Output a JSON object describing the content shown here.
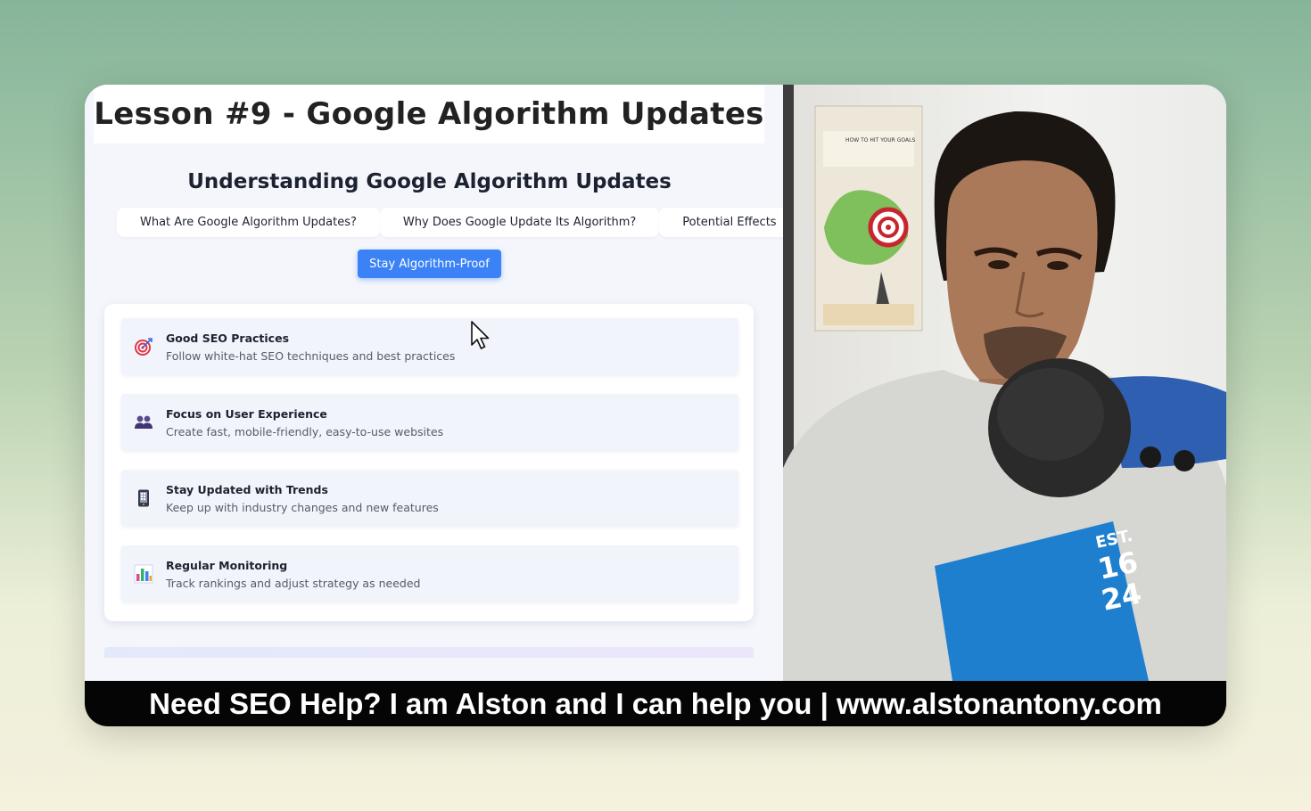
{
  "lesson_title": "Lesson #9 - Google Algorithm Updates",
  "slide": {
    "title": "Understanding Google Algorithm Updates",
    "tabs": [
      {
        "label": "What Are Google Algorithm Updates?"
      },
      {
        "label": "Why Does Google Update Its Algorithm?"
      },
      {
        "label": "Potential Effects"
      }
    ],
    "active_tab": {
      "label": "Stay Algorithm-Proof"
    },
    "items": [
      {
        "icon": "target-icon",
        "title": "Good SEO Practices",
        "desc": "Follow white-hat SEO techniques and best practices"
      },
      {
        "icon": "users-icon",
        "title": "Focus on User Experience",
        "desc": "Create fast, mobile-friendly, easy-to-use websites"
      },
      {
        "icon": "mobile-phone-icon",
        "title": "Stay Updated with Trends",
        "desc": "Keep up with industry changes and new features"
      },
      {
        "icon": "bar-chart-icon",
        "title": "Regular Monitoring",
        "desc": "Track rankings and adjust strategy as needed"
      }
    ]
  },
  "webcam": {
    "poster_heading": "HOW TO HIT YOUR GOALS",
    "shirt_text": [
      "EST.",
      "16",
      "24"
    ]
  },
  "banner": {
    "text": "Need SEO Help? I am Alston and I can help you | www.alstonantony.com"
  },
  "colors": {
    "accent": "#3b82f6",
    "banner_bg": "#050505"
  }
}
